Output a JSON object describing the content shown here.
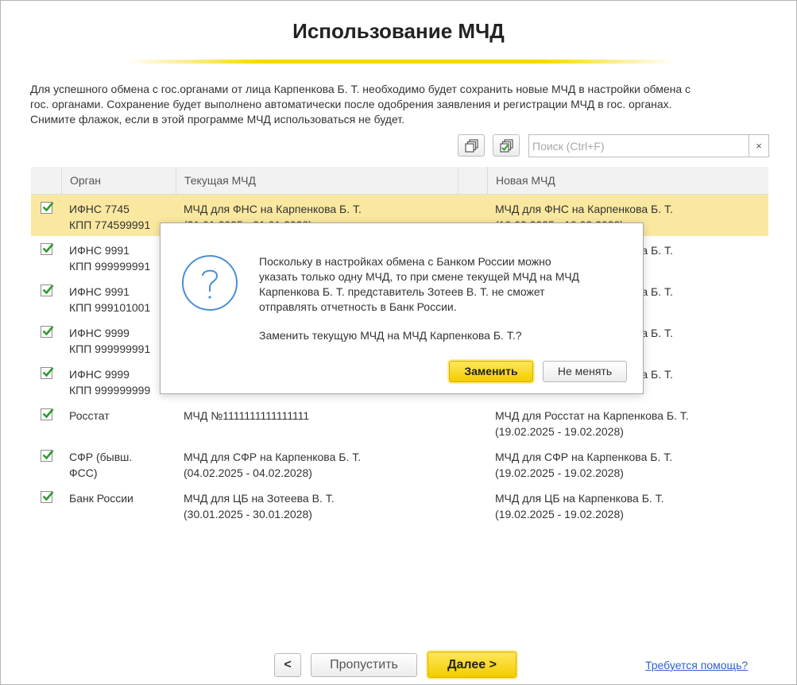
{
  "page": {
    "title": "Использование МЧД",
    "description_lines": [
      "Для успешного обмена с гос.органами от лица Карпенкова Б. Т. необходимо будет сохранить новые МЧД в настройки обмена с",
      "гос. органами. Сохранение будет выполнено автоматически после одобрения заявления и регистрации МЧД в гос. органах.",
      "Снимите флажок, если в этой программе МЧД использоваться не будет."
    ]
  },
  "toolbar": {
    "search_placeholder": "Поиск (Ctrl+F)",
    "clear_label": "×",
    "uncheck_all_icon": "uncheck-all-icon",
    "check_all_icon": "check-all-icon"
  },
  "table": {
    "columns": [
      "Орган",
      "Текущая МЧД",
      "Новая МЧД"
    ],
    "rows": [
      {
        "checked": true,
        "organ": [
          "ИФНС 7745",
          "КПП 774599991"
        ],
        "current": [
          "МЧД для ФНС на Карпенкова Б. Т.",
          "(31.01.2025 - 31.01.2028)"
        ],
        "new": [
          "МЧД для ФНС на Карпенкова Б. Т.",
          "(19.02.2025 - 19.02.2028)"
        ]
      },
      {
        "checked": true,
        "organ": [
          "ИФНС 9991",
          "КПП 999999991"
        ],
        "current": [
          "",
          ""
        ],
        "new": [
          "МЧД для ФНС на Карпенкова Б. Т.",
          ""
        ]
      },
      {
        "checked": true,
        "organ": [
          "ИФНС 9991",
          "КПП 999101001"
        ],
        "current": [
          "",
          ""
        ],
        "new": [
          "МЧД для ФНС на Карпенкова Б. Т.",
          ""
        ]
      },
      {
        "checked": true,
        "organ": [
          "ИФНС 9999",
          "КПП 999999991"
        ],
        "current": [
          "",
          ""
        ],
        "new": [
          "МЧД для ФНС на Карпенкова Б. Т.",
          ""
        ]
      },
      {
        "checked": true,
        "organ": [
          "ИФНС 9999",
          "КПП 999999999"
        ],
        "current": [
          "",
          ""
        ],
        "new": [
          "МЧД для ФНС на Карпенкова Б. Т.",
          ""
        ]
      },
      {
        "checked": true,
        "organ": [
          "Росстат",
          ""
        ],
        "current": [
          "МЧД №1111111111111111",
          ""
        ],
        "new": [
          "МЧД для Росстат на Карпенкова Б. Т.",
          "(19.02.2025 - 19.02.2028)"
        ]
      },
      {
        "checked": true,
        "organ": [
          "СФР (бывш.",
          "ФСС)"
        ],
        "current": [
          "МЧД для СФР на Карпенкова Б. Т.",
          "(04.02.2025 - 04.02.2028)"
        ],
        "new": [
          "МЧД для СФР на Карпенкова Б. Т.",
          "(19.02.2025 - 19.02.2028)"
        ]
      },
      {
        "checked": true,
        "organ": [
          "Банк России",
          ""
        ],
        "current": [
          "МЧД для ЦБ на Зотеева В. Т.",
          "(30.01.2025 - 30.01.2028)"
        ],
        "new": [
          "МЧД для ЦБ на Карпенкова Б. Т.",
          "(19.02.2025 - 19.02.2028)"
        ]
      }
    ]
  },
  "dialog": {
    "icon": "question-icon",
    "message_lines": [
      "Поскольку в настройках обмена с Банком России можно",
      "указать только одну МЧД, то при смене текущей МЧД на МЧД",
      "Карпенкова Б. Т. представитель Зотеев В. Т. не сможет",
      "отправлять отчетность в Банк России."
    ],
    "question": "Заменить текущую МЧД на МЧД Карпенкова Б. Т.?",
    "confirm_label": "Заменить",
    "cancel_label": "Не менять"
  },
  "footer": {
    "back_label": "<",
    "skip_label": "Пропустить",
    "next_label": "Далее >",
    "help_label": "Требуется помощь?"
  },
  "colors": {
    "accent_yellow": "#f6d700",
    "selected_row": "#fae8a0",
    "checkbox_green": "#2e9b2e",
    "link_blue": "#2c63c8",
    "icon_blue": "#4a8ed6"
  }
}
